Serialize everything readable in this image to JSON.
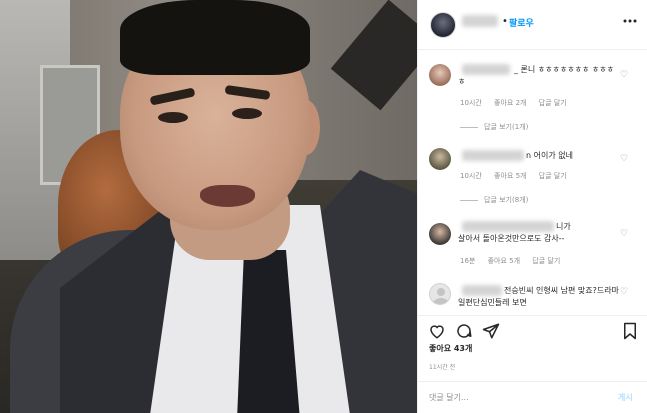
{
  "post": {
    "header": {
      "dot": "•",
      "follow_label": "팔로우",
      "more_icon": "more-horizontal-icon"
    },
    "comments": [
      {
        "text": "_ 론니 ㅎㅎㅎㅎㅎㅎㅎ ㅎㅎㅎㅎ",
        "time": "10시간",
        "likes": "좋아요 2개",
        "reply": "답글 달기",
        "view_replies": "답글 보기(1개)"
      },
      {
        "text": "n 어이가 없네",
        "time": "10시간",
        "likes": "좋아요 5개",
        "reply": "답글 달기",
        "view_replies": "답글 보기(8개)"
      },
      {
        "text": "니가 살아서 돌아온것만으로도 감사--",
        "time": "16분",
        "likes": "좋아요 5개",
        "reply": "답글 달기"
      },
      {
        "text": "전승빈씨 인형씨 남편 맞죠?드라마 일편단심민들레 보면"
      }
    ],
    "likes_count": "좋아요 43개",
    "posted_time": "11시간 전",
    "comment_placeholder": "댓글 달기...",
    "post_button": "게시"
  }
}
